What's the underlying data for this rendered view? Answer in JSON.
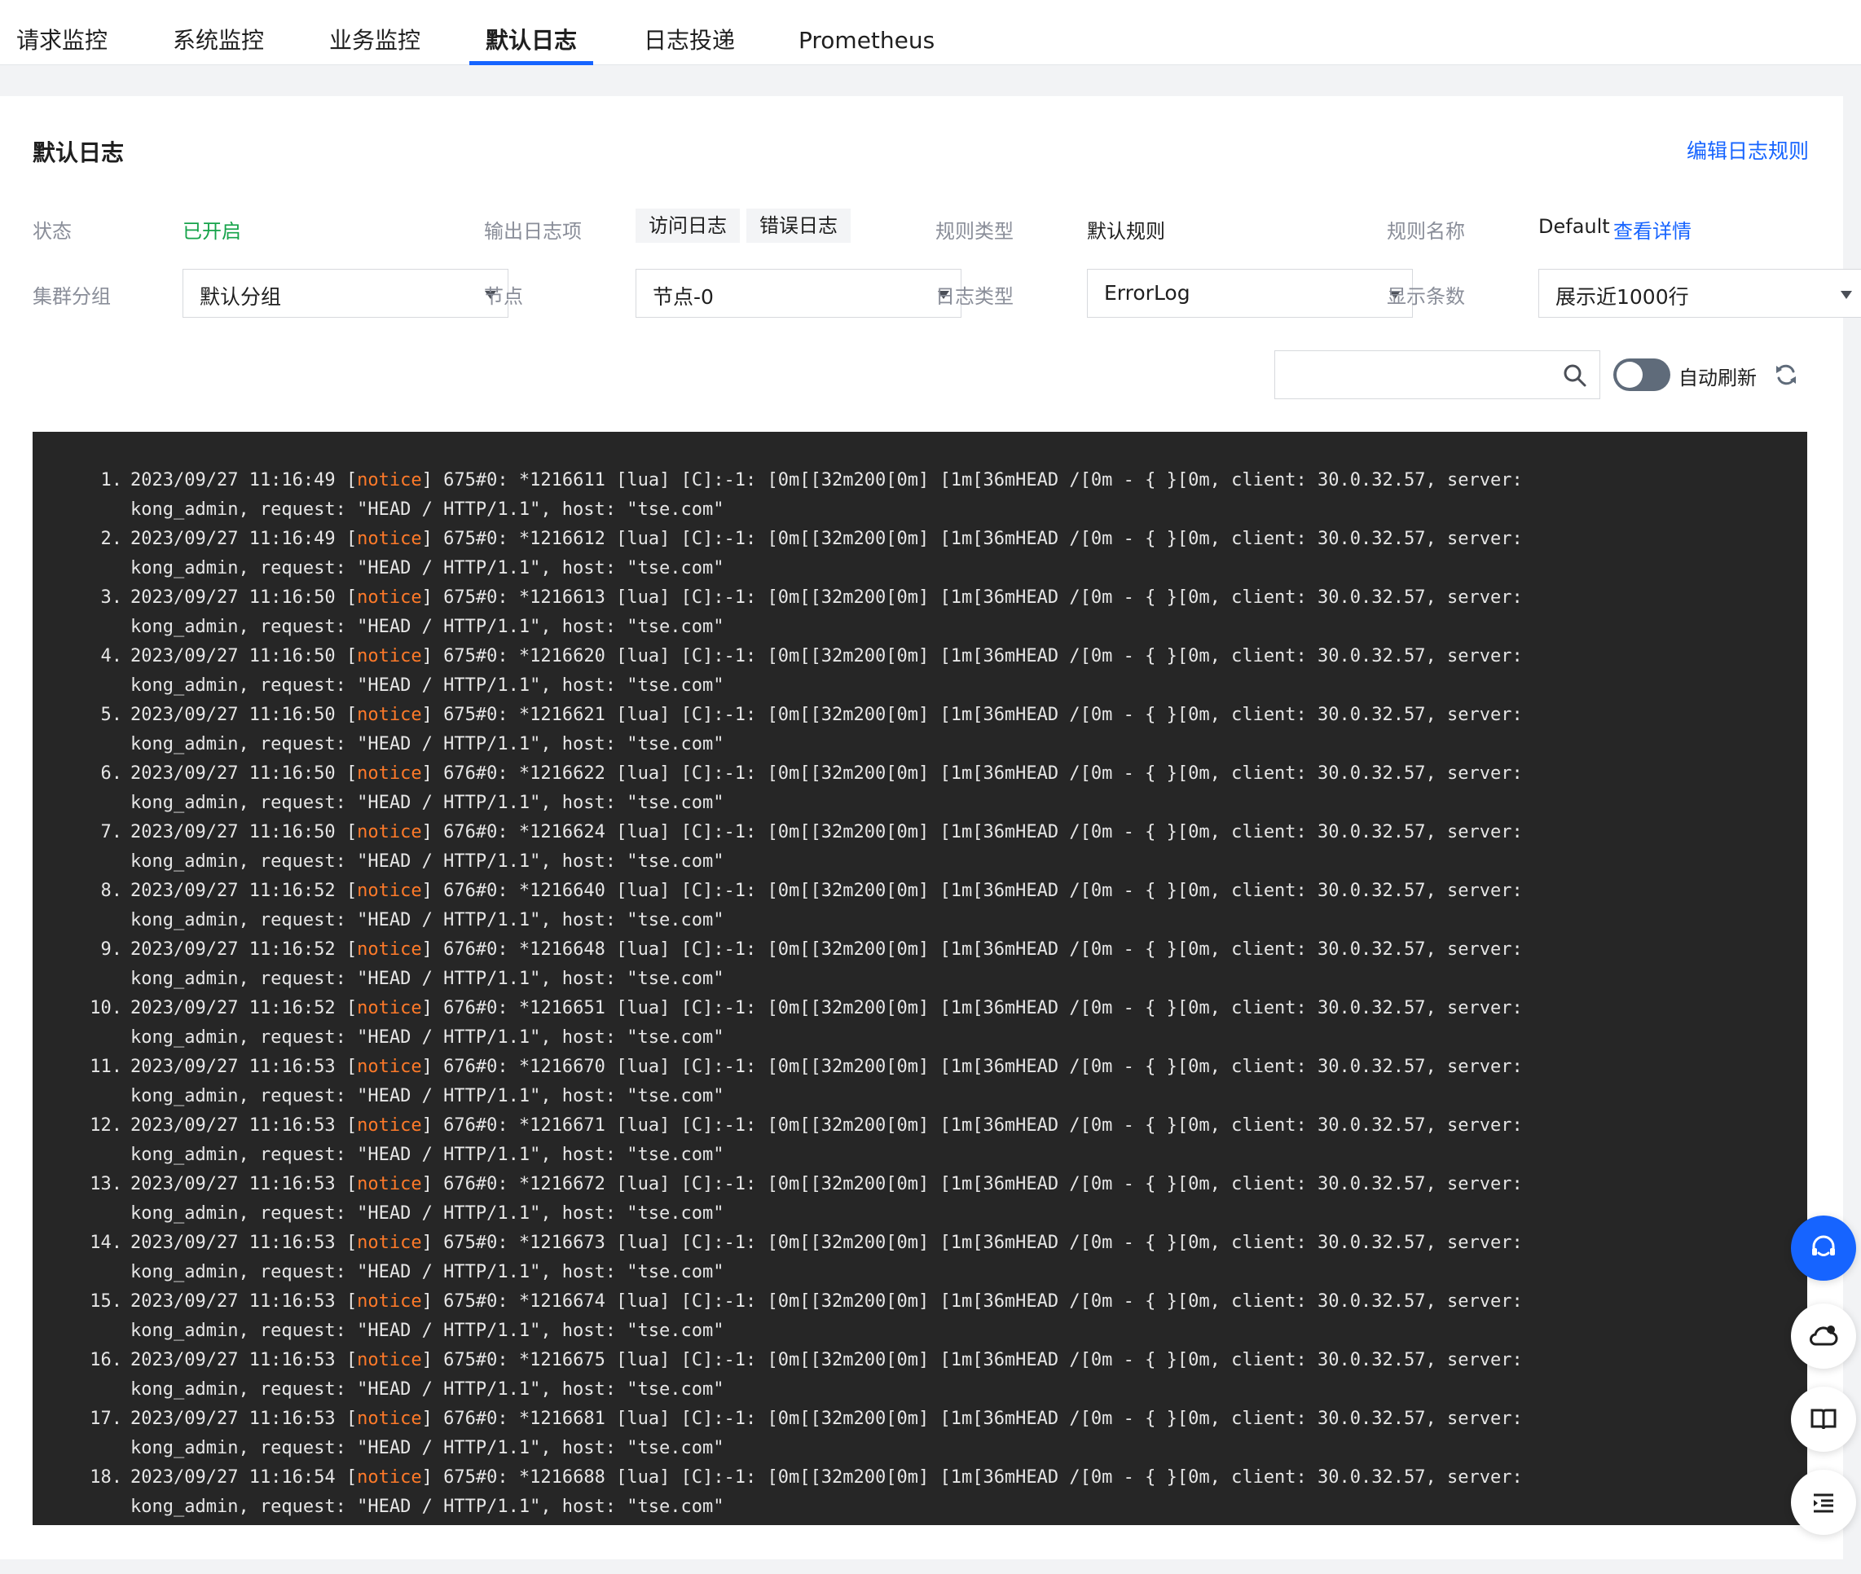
{
  "tabs": [
    {
      "label": "请求监控"
    },
    {
      "label": "系统监控"
    },
    {
      "label": "业务监控"
    },
    {
      "label": "默认日志"
    },
    {
      "label": "日志投递"
    },
    {
      "label": "Prometheus"
    }
  ],
  "panel": {
    "title": "默认日志",
    "edit_link": "编辑日志规则"
  },
  "info": {
    "status_label": "状态",
    "status_value": "已开启",
    "output_label": "输出日志项",
    "output_items": [
      "访问日志",
      "错误日志"
    ],
    "rule_type_label": "规则类型",
    "rule_type_value": "默认规则",
    "rule_name_label": "规则名称",
    "rule_name_value": "Default",
    "rule_detail_link": "查看详情"
  },
  "filters": {
    "cluster_group_label": "集群分组",
    "cluster_group_value": "默认分组",
    "node_label": "节点",
    "node_value": "节点-0",
    "log_type_label": "日志类型",
    "log_type_value": "ErrorLog",
    "show_count_label": "显示条数",
    "show_count_value": "展示近1000行"
  },
  "toolbar": {
    "search_value": "",
    "auto_refresh_label": "自动刷新",
    "auto_refresh_on": false
  },
  "logs": [
    {
      "n": "1.",
      "ts": "2023/09/27 11:16:49",
      "level": "notice",
      "pid": "675#0:",
      "id": "*1216611"
    },
    {
      "n": "2.",
      "ts": "2023/09/27 11:16:49",
      "level": "notice",
      "pid": "675#0:",
      "id": "*1216612"
    },
    {
      "n": "3.",
      "ts": "2023/09/27 11:16:50",
      "level": "notice",
      "pid": "675#0:",
      "id": "*1216613"
    },
    {
      "n": "4.",
      "ts": "2023/09/27 11:16:50",
      "level": "notice",
      "pid": "675#0:",
      "id": "*1216620"
    },
    {
      "n": "5.",
      "ts": "2023/09/27 11:16:50",
      "level": "notice",
      "pid": "675#0:",
      "id": "*1216621"
    },
    {
      "n": "6.",
      "ts": "2023/09/27 11:16:50",
      "level": "notice",
      "pid": "676#0:",
      "id": "*1216622"
    },
    {
      "n": "7.",
      "ts": "2023/09/27 11:16:50",
      "level": "notice",
      "pid": "676#0:",
      "id": "*1216624"
    },
    {
      "n": "8.",
      "ts": "2023/09/27 11:16:52",
      "level": "notice",
      "pid": "676#0:",
      "id": "*1216640"
    },
    {
      "n": "9.",
      "ts": "2023/09/27 11:16:52",
      "level": "notice",
      "pid": "676#0:",
      "id": "*1216648"
    },
    {
      "n": "10.",
      "ts": "2023/09/27 11:16:52",
      "level": "notice",
      "pid": "676#0:",
      "id": "*1216651"
    },
    {
      "n": "11.",
      "ts": "2023/09/27 11:16:53",
      "level": "notice",
      "pid": "676#0:",
      "id": "*1216670"
    },
    {
      "n": "12.",
      "ts": "2023/09/27 11:16:53",
      "level": "notice",
      "pid": "676#0:",
      "id": "*1216671"
    },
    {
      "n": "13.",
      "ts": "2023/09/27 11:16:53",
      "level": "notice",
      "pid": "676#0:",
      "id": "*1216672"
    },
    {
      "n": "14.",
      "ts": "2023/09/27 11:16:53",
      "level": "notice",
      "pid": "675#0:",
      "id": "*1216673"
    },
    {
      "n": "15.",
      "ts": "2023/09/27 11:16:53",
      "level": "notice",
      "pid": "675#0:",
      "id": "*1216674"
    },
    {
      "n": "16.",
      "ts": "2023/09/27 11:16:53",
      "level": "notice",
      "pid": "675#0:",
      "id": "*1216675"
    },
    {
      "n": "17.",
      "ts": "2023/09/27 11:16:53",
      "level": "notice",
      "pid": "676#0:",
      "id": "*1216681"
    },
    {
      "n": "18.",
      "ts": "2023/09/27 11:16:54",
      "level": "notice",
      "pid": "675#0:",
      "id": "*1216688"
    }
  ],
  "log_common": {
    "mid": "[lua] [C]:-1: [0m[[32m200[0m] [1m[36mHEAD /[0m - {  }[0m, client: 30.0.32.57, server:",
    "line2": "kong_admin, request: \"HEAD / HTTP/1.1\", host: \"tse.com\""
  },
  "floating": [
    "headset-icon",
    "cloud-icon",
    "book-icon",
    "list-indent-icon"
  ],
  "colors": {
    "accent": "#1664ff",
    "status_on": "#16a34a",
    "notice": "#ff7a29",
    "console_bg": "#262626"
  }
}
